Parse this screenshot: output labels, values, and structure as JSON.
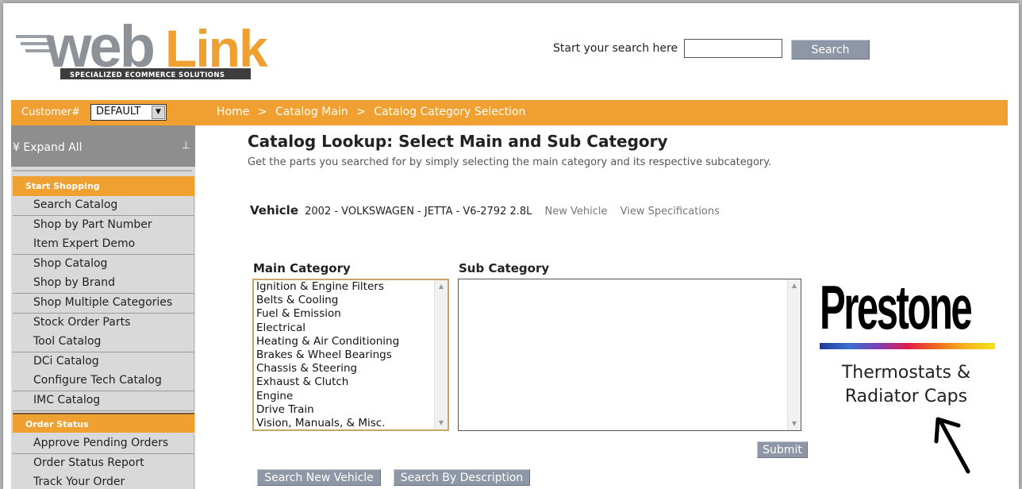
{
  "header": {
    "search_label": "Start your search here",
    "search_value": "",
    "search_button": "Search"
  },
  "logo": {
    "text_web": "web",
    "text_link": "Link",
    "tagline": "SPECIALIZED ECOMMERCE SOLUTIONS"
  },
  "topbar": {
    "customer_label": "Customer#",
    "customer_value": "DEFAULT",
    "breadcrumb": [
      "Home",
      ">",
      "Catalog Main",
      ">",
      "Catalog Category Selection"
    ]
  },
  "sidebar": {
    "expand_all": "Expand All",
    "sections": [
      {
        "title": "Start Shopping",
        "items": [
          "Search Catalog",
          "Shop by Part Number",
          "Item Expert Demo",
          "Shop Catalog",
          "Shop by Brand",
          "Shop Multiple Categories",
          "Stock Order Parts",
          "Tool Catalog",
          "DCi Catalog",
          "Configure Tech Catalog",
          "IMC Catalog"
        ]
      },
      {
        "title": "Order Status",
        "items": [
          "Approve Pending Orders",
          "Order Status Report",
          "Track Your Order"
        ]
      }
    ]
  },
  "main": {
    "title": "Catalog Lookup: Select Main and Sub Category",
    "subtitle": "Get the parts you searched for by simply selecting the main category and its respective subcategory.",
    "vehicle_label": "Vehicle",
    "vehicle_value": "2002 - VOLKSWAGEN - JETTA - V6-2792 2.8L",
    "new_vehicle_link": "New Vehicle",
    "view_specs_link": "View Specifications",
    "main_category_title": "Main Category",
    "sub_category_title": "Sub Category",
    "main_categories": [
      "Ignition & Engine Filters",
      "Belts & Cooling",
      "Fuel & Emission",
      "Electrical",
      "Heating & Air Conditioning",
      "Brakes & Wheel Bearings",
      "Chassis & Steering",
      "Exhaust & Clutch",
      "Engine",
      "Drive Train",
      "Vision, Manuals, & Misc."
    ],
    "sub_categories": [],
    "submit_button": "Submit",
    "search_new_vehicle_button": "Search New Vehicle",
    "search_by_description_button": "Search By Description"
  },
  "ad": {
    "brand": "Prestone",
    "line1": "Thermostats &",
    "line2": "Radiator Caps"
  },
  "colors": {
    "accent_orange": "#f0a030",
    "button_gray": "#8e97a6",
    "sidebar_gray": "#d9d9d9"
  }
}
